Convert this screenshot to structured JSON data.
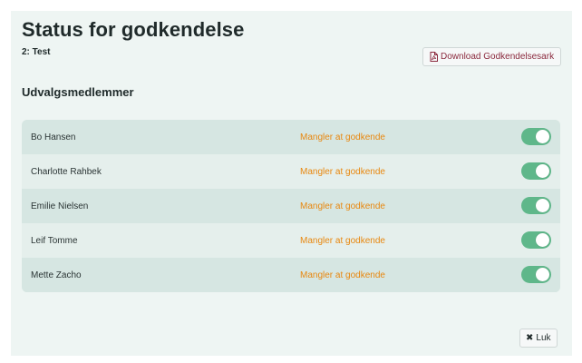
{
  "dialog": {
    "title": "Status for godkendelse",
    "subtitle": "2: Test",
    "download_label": "Download Godkendelsesark",
    "section_title": "Udvalgsmedlemmer",
    "close_label": "Luk"
  },
  "members": [
    {
      "name": "Bo Hansen",
      "status": "Mangler at godkende",
      "toggle_on": true
    },
    {
      "name": "Charlotte Rahbek",
      "status": "Mangler at godkende",
      "toggle_on": true
    },
    {
      "name": "Emilie Nielsen",
      "status": "Mangler at godkende",
      "toggle_on": true
    },
    {
      "name": "Leif Tomme",
      "status": "Mangler at godkende",
      "toggle_on": true
    },
    {
      "name": "Mette Zacho",
      "status": "Mangler at godkende",
      "toggle_on": true
    }
  ],
  "icons": {
    "download": "pdf-file-icon",
    "close": "close-icon"
  },
  "colors": {
    "status": "#e8870e",
    "toggle_on": "#5fb78a",
    "download_text": "#8b2a3e"
  }
}
